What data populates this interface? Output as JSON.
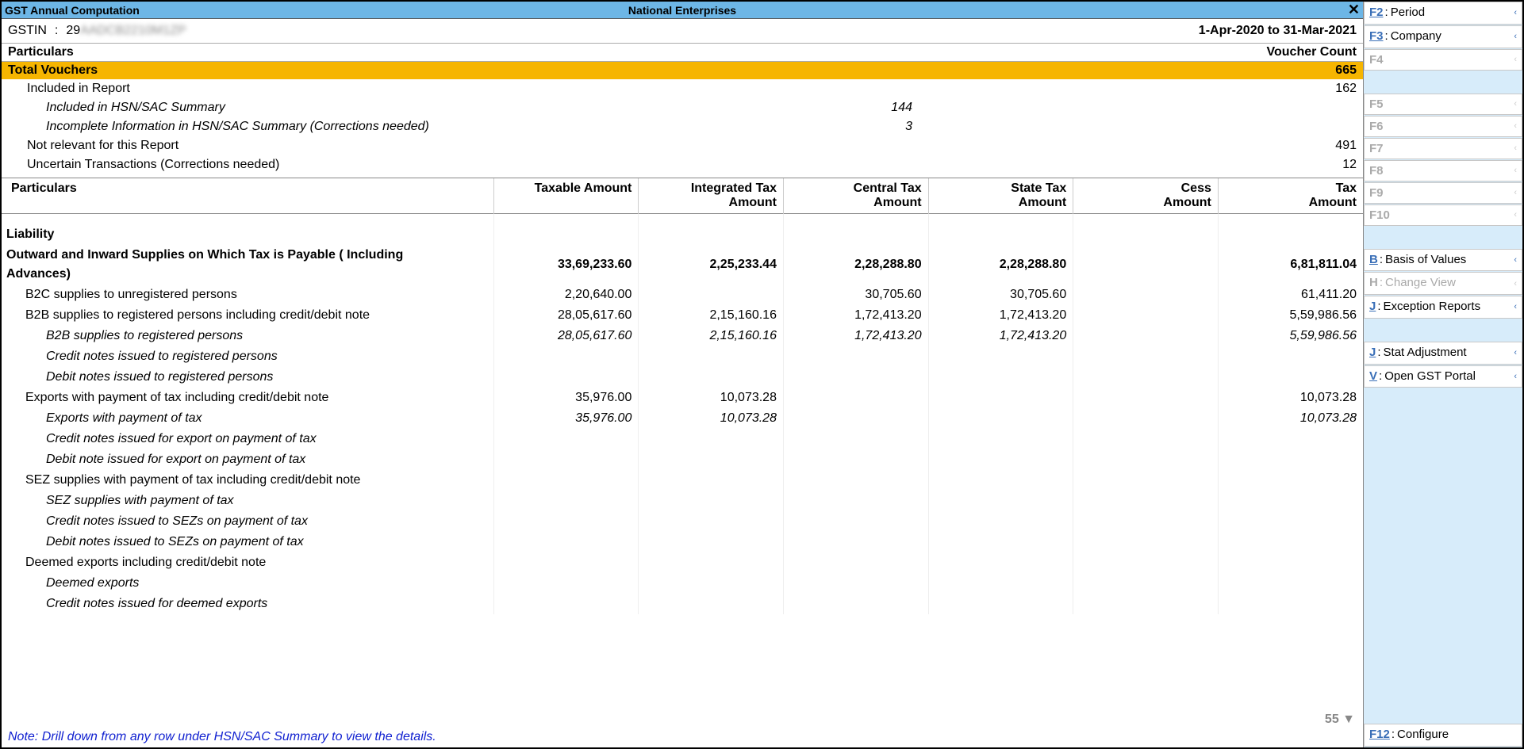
{
  "titlebar": {
    "report_name": "GST Annual Computation",
    "company": "National Enterprises"
  },
  "info": {
    "gstin_label": "GSTIN",
    "gstin_prefix": "29",
    "gstin_masked": "AADCB2210M1ZP",
    "period": "1-Apr-2020 to 31-Mar-2021"
  },
  "voucher_header": {
    "left": "Particulars",
    "right": "Voucher Count"
  },
  "vouchers": {
    "total_label": "Total Vouchers",
    "total": "665",
    "included_label": "Included in Report",
    "included": "162",
    "hsn_label": "Included in HSN/SAC Summary",
    "hsn": "144",
    "incomplete_label": "Incomplete Information in HSN/SAC Summary (Corrections needed)",
    "incomplete": "3",
    "not_relevant_label": "Not relevant for this Report",
    "not_relevant": "491",
    "uncertain_label": "Uncertain Transactions (Corrections needed)",
    "uncertain": "12"
  },
  "columns": {
    "c0": "Particulars",
    "c1a": "Taxable Amount",
    "c1b": "",
    "c2a": "Integrated Tax",
    "c2b": "Amount",
    "c3a": "Central Tax",
    "c3b": "Amount",
    "c4a": "State Tax",
    "c4b": "Amount",
    "c5a": "Cess",
    "c5b": "Amount",
    "c6a": "Tax",
    "c6b": "Amount"
  },
  "liability_label": "Liability",
  "rows": {
    "outward": {
      "label": "Outward and Inward Supplies on Which Tax is Payable ( Including Advances)",
      "taxable": "33,69,233.60",
      "igst": "2,25,233.44",
      "cgst": "2,28,288.80",
      "sgst": "2,28,288.80",
      "cess": "",
      "tax": "6,81,811.04"
    },
    "b2c": {
      "label": "B2C supplies to unregistered persons",
      "taxable": "2,20,640.00",
      "igst": "",
      "cgst": "30,705.60",
      "sgst": "30,705.60",
      "cess": "",
      "tax": "61,411.20"
    },
    "b2b": {
      "label": "B2B supplies to registered persons including credit/debit note",
      "taxable": "28,05,617.60",
      "igst": "2,15,160.16",
      "cgst": "1,72,413.20",
      "sgst": "1,72,413.20",
      "cess": "",
      "tax": "5,59,986.56"
    },
    "b2b_sub": {
      "label": "B2B supplies to registered persons",
      "taxable": "28,05,617.60",
      "igst": "2,15,160.16",
      "cgst": "1,72,413.20",
      "sgst": "1,72,413.20",
      "cess": "",
      "tax": "5,59,986.56"
    },
    "b2b_cn": {
      "label": "Credit notes issued to registered persons"
    },
    "b2b_dn": {
      "label": "Debit notes issued to registered persons"
    },
    "exp": {
      "label": "Exports with payment of tax including credit/debit note",
      "taxable": "35,976.00",
      "igst": "10,073.28",
      "cgst": "",
      "sgst": "",
      "cess": "",
      "tax": "10,073.28"
    },
    "exp_sub": {
      "label": "Exports with payment of tax",
      "taxable": "35,976.00",
      "igst": "10,073.28",
      "cgst": "",
      "sgst": "",
      "cess": "",
      "tax": "10,073.28"
    },
    "exp_cn": {
      "label": "Credit notes issued for export on payment of tax"
    },
    "exp_dn": {
      "label": "Debit note issued for export on payment of tax"
    },
    "sez": {
      "label": "SEZ supplies with payment of tax including credit/debit note"
    },
    "sez_sub": {
      "label": "SEZ supplies with payment of tax"
    },
    "sez_cn": {
      "label": "Credit notes issued to SEZs on payment of tax"
    },
    "sez_dn": {
      "label": "Debit notes issued to SEZs on payment of tax"
    },
    "deemed": {
      "label": "Deemed exports including credit/debit note"
    },
    "deemed_sub": {
      "label": "Deemed exports"
    },
    "deemed_cn": {
      "label": "Credit notes issued for deemed exports"
    }
  },
  "page_indicator": "55 ▼",
  "note": "Note: Drill down from any row under HSN/SAC Summary to view the details.",
  "sidebar": {
    "f2": "Period",
    "f3": "Company",
    "f4": "",
    "b": "Basis of Values",
    "h": "Change View",
    "j1": "Exception Reports",
    "j2": "Stat Adjustment",
    "v": "Open GST Portal",
    "f12": "Configure"
  }
}
